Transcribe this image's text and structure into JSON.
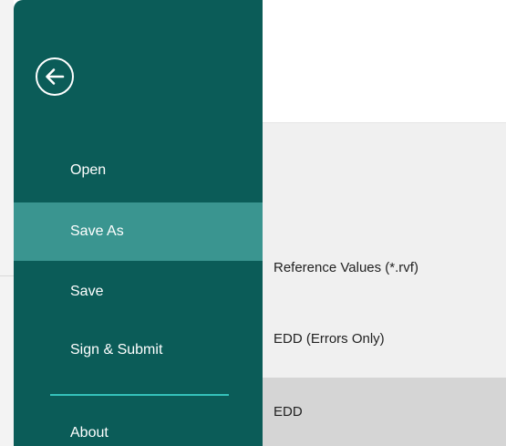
{
  "backstage": {
    "back_icon": "arrow-left-circle-icon",
    "menu": [
      {
        "label": "Open",
        "active": false
      },
      {
        "label": "Save As",
        "active": true
      },
      {
        "label": "Save",
        "active": false
      },
      {
        "label": "Sign & Submit",
        "active": false
      },
      {
        "label": "About",
        "active": false
      }
    ]
  },
  "save_as_options": [
    {
      "label": "Reference Values (*.rvf)",
      "selected": false
    },
    {
      "label": "EDD (Errors Only)",
      "selected": false
    },
    {
      "label": "EDD",
      "selected": true
    }
  ],
  "colors": {
    "panel": "#0b5c58",
    "active_item": "#3a9590",
    "divider": "#35c2bb",
    "options_background": "#f0f0f0",
    "selected_option": "#d5d5d5"
  }
}
